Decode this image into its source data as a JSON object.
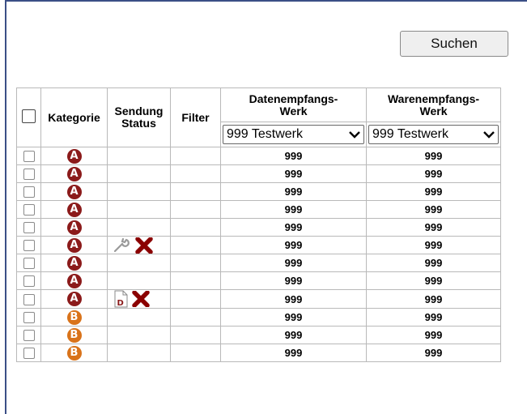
{
  "search": {
    "label": "Suchen"
  },
  "columns": {
    "kategorie": "Kategorie",
    "sendung": "Sendung",
    "status": "Status",
    "filter": "Filter",
    "daten_line1": "Datenempfangs-",
    "daten_line2": "Werk",
    "waren_line1": "Warenempfangs-",
    "waren_line2": "Werk"
  },
  "filters": {
    "daten_werk": "999 Testwerk",
    "waren_werk": "999 Testwerk"
  },
  "colors": {
    "category_a": "#8b1a1a",
    "category_b": "#d9731a",
    "delete": "#8b0000",
    "frame": "#3b4f86"
  },
  "rows": [
    {
      "category": "A",
      "status_icons": [],
      "daten": "999",
      "waren": "999"
    },
    {
      "category": "A",
      "status_icons": [],
      "daten": "999",
      "waren": "999"
    },
    {
      "category": "A",
      "status_icons": [],
      "daten": "999",
      "waren": "999"
    },
    {
      "category": "A",
      "status_icons": [],
      "daten": "999",
      "waren": "999"
    },
    {
      "category": "A",
      "status_icons": [],
      "daten": "999",
      "waren": "999"
    },
    {
      "category": "A",
      "status_icons": [
        "wrench-icon",
        "delete-x-icon"
      ],
      "daten": "999",
      "waren": "999"
    },
    {
      "category": "A",
      "status_icons": [],
      "daten": "999",
      "waren": "999"
    },
    {
      "category": "A",
      "status_icons": [],
      "daten": "999",
      "waren": "999"
    },
    {
      "category": "A",
      "status_icons": [
        "document-d-icon",
        "delete-x-icon"
      ],
      "daten": "999",
      "waren": "999"
    },
    {
      "category": "B",
      "status_icons": [],
      "daten": "999",
      "waren": "999"
    },
    {
      "category": "B",
      "status_icons": [],
      "daten": "999",
      "waren": "999"
    },
    {
      "category": "B",
      "status_icons": [],
      "daten": "999",
      "waren": "999"
    }
  ]
}
